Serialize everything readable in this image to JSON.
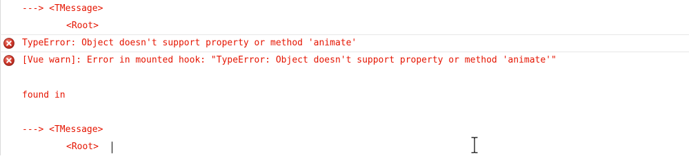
{
  "console": {
    "lines": [
      {
        "text": "---> <TMessage>"
      },
      {
        "text": "<Root>"
      },
      {
        "text": "TypeError: Object doesn't support property or method 'animate'",
        "icon": "error-icon"
      },
      {
        "text": "[Vue warn]: Error in mounted hook: \"TypeError: Object doesn't support property or method 'animate'\"",
        "icon": "error-icon"
      },
      {
        "text": ""
      },
      {
        "text": "found in"
      },
      {
        "text": ""
      },
      {
        "text": "---> <TMessage>"
      },
      {
        "text": "<Root>"
      }
    ]
  },
  "colors": {
    "error_text": "#e51400",
    "error_icon": "#c0392b"
  },
  "cursor": {
    "type": "text-cursor-ibeam-icon"
  }
}
